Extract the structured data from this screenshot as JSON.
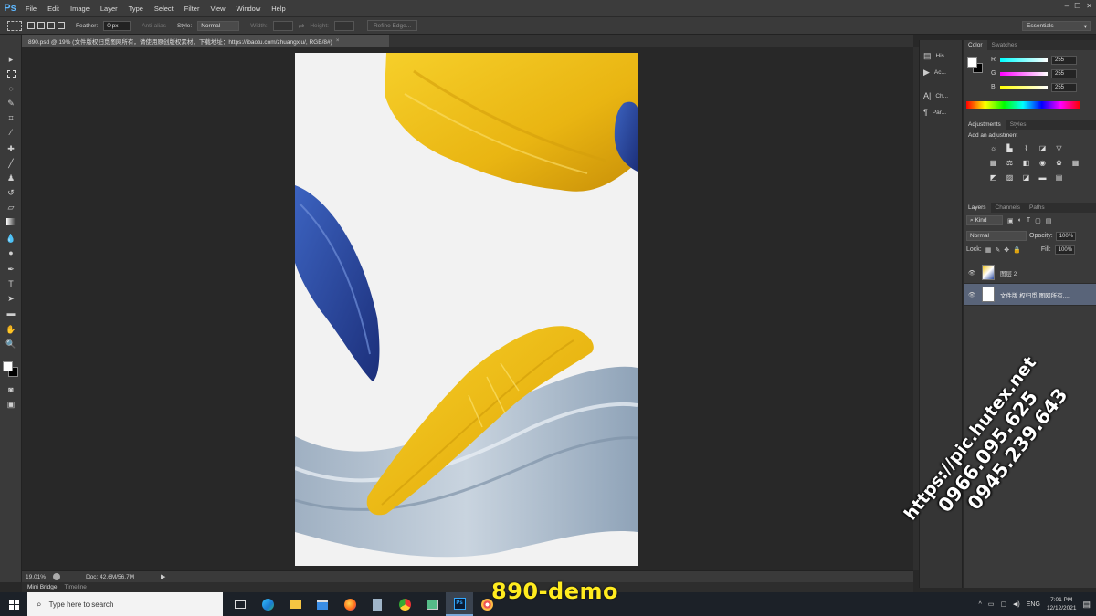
{
  "menubar": {
    "logo": "Ps",
    "items": [
      "File",
      "Edit",
      "Image",
      "Layer",
      "Type",
      "Select",
      "Filter",
      "View",
      "Window",
      "Help"
    ],
    "window_controls": [
      "–",
      "☐",
      "✕"
    ]
  },
  "options": {
    "feather_label": "Feather:",
    "feather_value": "0 px",
    "antialias_label": "Anti-alias",
    "style_label": "Style:",
    "style_value": "Normal",
    "width_label": "Width:",
    "height_label": "Height:",
    "refine_edge": "Refine Edge...",
    "workspace": "Essentials"
  },
  "document": {
    "tab_title": "890.psd @ 19% (文件版权归觅图网所有，请使用原创版权素材，下载地址：https://ibaotu.com/zhuangxiu/, RGB/8#)",
    "close": "×"
  },
  "status": {
    "zoom": "19.01%",
    "doc_size": "Doc: 42.6M/56.7M"
  },
  "bottom_tabs": [
    "Mini Bridge",
    "Timeline"
  ],
  "icon_strip": [
    {
      "label": "His...",
      "icon": "history-icon"
    },
    {
      "label": "Ac...",
      "icon": "actions-icon"
    },
    {
      "label": "Ch...",
      "icon": "character-icon"
    },
    {
      "label": "Par...",
      "icon": "paragraph-icon"
    }
  ],
  "color_panel": {
    "tabs": [
      "Color",
      "Swatches"
    ],
    "channels": [
      {
        "label": "R",
        "value": "255",
        "color": "#ff2222"
      },
      {
        "label": "G",
        "value": "255",
        "color": "#22cc22"
      },
      {
        "label": "B",
        "value": "255",
        "color": "#2244ff"
      }
    ]
  },
  "adjustments_panel": {
    "tabs": [
      "Adjustments",
      "Styles"
    ],
    "heading": "Add an adjustment"
  },
  "layers_panel": {
    "tabs": [
      "Layers",
      "Channels",
      "Paths"
    ],
    "kind": "Kind",
    "blend_mode": "Normal",
    "opacity_label": "Opacity:",
    "opacity_value": "100%",
    "lock_label": "Lock:",
    "fill_label": "Fill:",
    "fill_value": "100%",
    "layers": [
      {
        "name": "图层 2",
        "selected": false
      },
      {
        "name": "文件版 权归觅 图网所有,...",
        "selected": true
      }
    ]
  },
  "taskbar": {
    "search_placeholder": "Type here to search",
    "lang": "ENG",
    "time": "7:01 PM",
    "date": "12/12/2021"
  },
  "watermark": {
    "demo": "890-demo",
    "lines": [
      "https://pic.hutex.net",
      "0966.095.625",
      "0945.239.643"
    ]
  },
  "colors": {
    "accent_yellow": "#f2c417",
    "feather_blue": "#2a4aa0",
    "canvas_bg": "#f2f2f2"
  }
}
